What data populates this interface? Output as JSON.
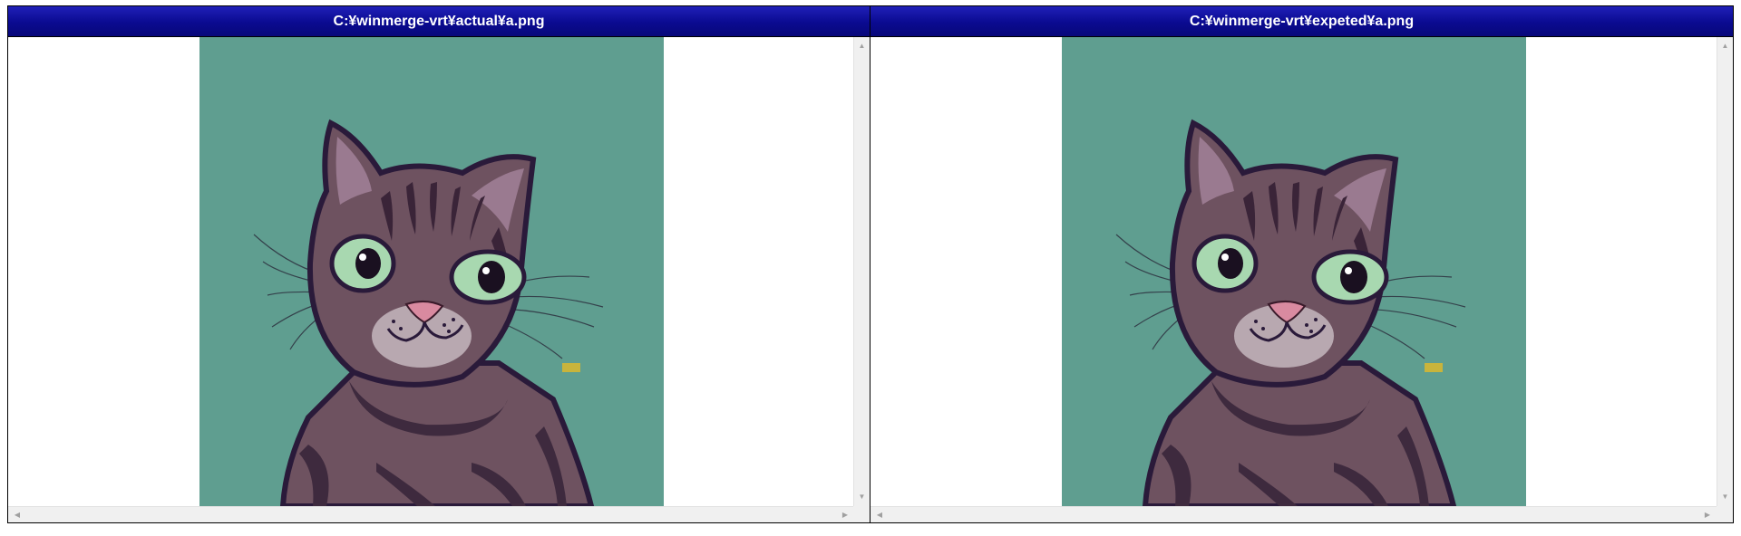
{
  "left_pane": {
    "title": "C:¥winmerge-vrt¥actual¥a.png",
    "image": "tabby-cat-illustration"
  },
  "right_pane": {
    "title": "C:¥winmerge-vrt¥expeted¥a.png",
    "image": "tabby-cat-illustration"
  },
  "icons": {
    "scroll_up": "triangle-up",
    "scroll_down": "triangle-down",
    "scroll_left": "triangle-left",
    "scroll_right": "triangle-right"
  },
  "colors": {
    "header_bg": "#0a0a90",
    "image_bg": "#5f9e90",
    "cat_fur": "#6e5260",
    "cat_outline": "#2a1a3a",
    "diff_marker": "#c8b43c",
    "eye": "#a8d8b0"
  }
}
